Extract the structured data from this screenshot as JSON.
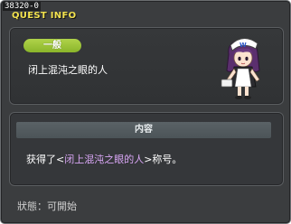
{
  "window": {
    "quest_id": "38320-0",
    "title": "QUEST INFO"
  },
  "quest": {
    "category_badge": "一般",
    "name": "闭上混沌之眼的人",
    "npc_icon": "maid-girl-npc-icon"
  },
  "content": {
    "header": "内容",
    "text_prefix": "获得了<",
    "text_highlight": "闭上混沌之眼的人",
    "text_suffix": ">称号。"
  },
  "status": {
    "label": "狀態",
    "separator": "：",
    "value": "可開始"
  },
  "colors": {
    "window_bg": "#3b3d3f",
    "title": "#f2e24f",
    "badge": "#9cc33a",
    "highlight": "#d9a6f5"
  }
}
